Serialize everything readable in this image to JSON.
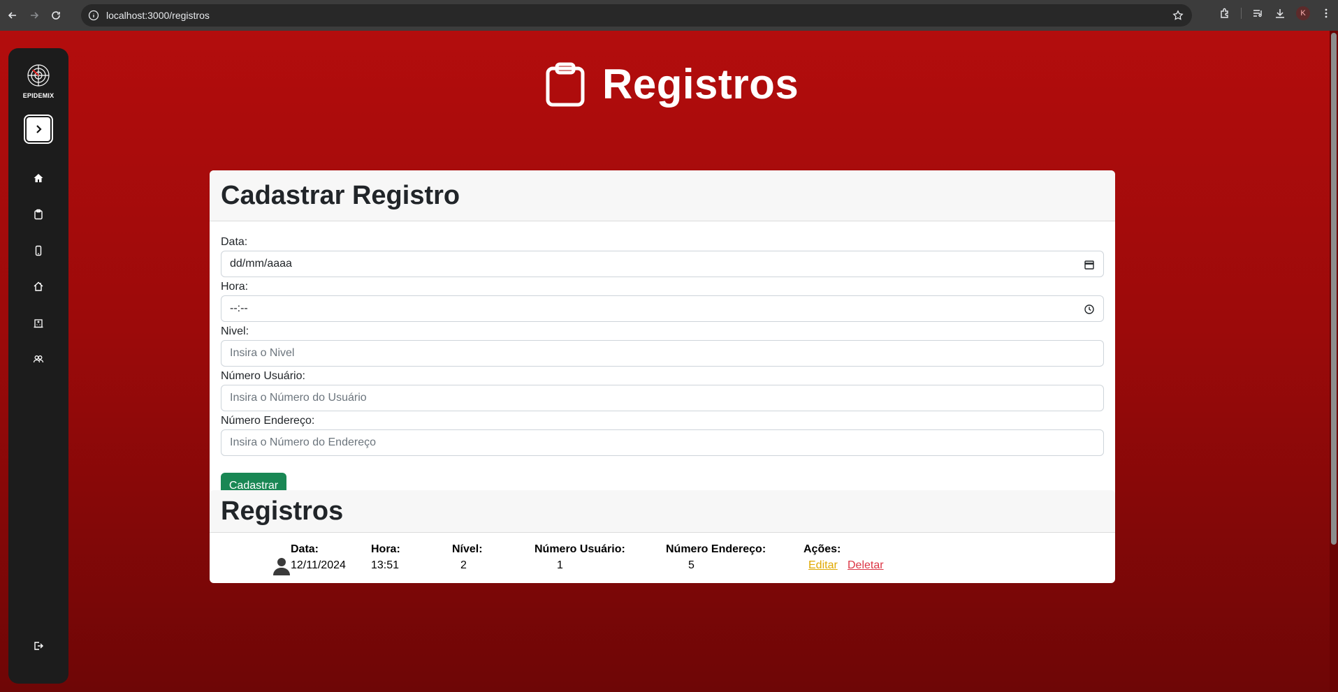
{
  "browser": {
    "url": "localhost:3000/registros",
    "profile_initial": "K"
  },
  "sidebar": {
    "logo_text": "EPIDEMIX",
    "toggle_icon": "chevron-right-icon",
    "items": [
      {
        "icon": "home-icon"
      },
      {
        "icon": "clipboard-icon"
      },
      {
        "icon": "phone-icon"
      },
      {
        "icon": "house-icon"
      },
      {
        "icon": "hospital-icon"
      },
      {
        "icon": "people-icon"
      }
    ],
    "logout_icon": "logout-icon"
  },
  "page": {
    "title": "Registros",
    "title_icon": "clipboard-icon"
  },
  "form": {
    "header": "Cadastrar Registro",
    "fields": [
      {
        "label": "Data:",
        "value": "dd/mm/aaaa",
        "type": "date"
      },
      {
        "label": "Hora:",
        "value": "--:--",
        "type": "time"
      },
      {
        "label": "Nivel:",
        "placeholder": "Insira o Nivel"
      },
      {
        "label": "Número Usuário:",
        "placeholder": "Insira o Número do Usuário"
      },
      {
        "label": "Número Endereço:",
        "placeholder": "Insira o Número do Endereço"
      }
    ],
    "submit_label": "Cadastrar"
  },
  "list": {
    "header": "Registros",
    "columns": [
      "Data:",
      "Hora:",
      "Nível:",
      "Número Usuário:",
      "Número Endereço:",
      "Ações:"
    ],
    "rows": [
      {
        "data": "12/11/2024",
        "hora": "13:51",
        "nivel": "2",
        "usuario": "1",
        "endereco": "5",
        "edit_label": "Editar",
        "delete_label": "Deletar"
      }
    ]
  },
  "colors": {
    "brand_red": "#b30d0d",
    "sidebar_bg": "#1c1c1c",
    "submit_green": "#198754",
    "edit_yellow": "#e0a800",
    "delete_red": "#dc3545"
  }
}
